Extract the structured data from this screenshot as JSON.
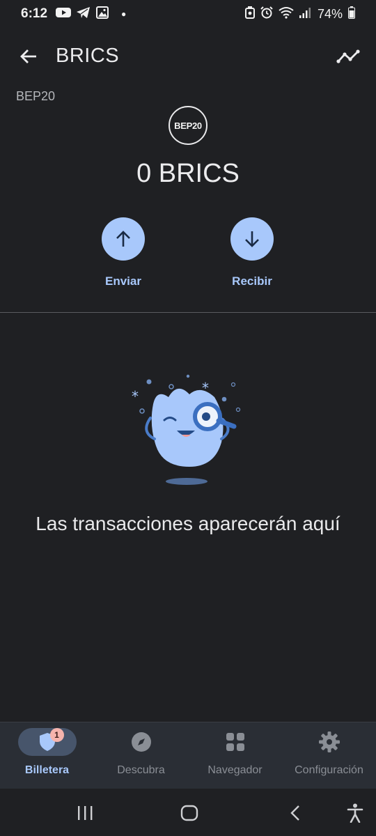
{
  "status_bar": {
    "time": "6:12",
    "battery": "74%",
    "icons_left": [
      "youtube-icon",
      "telegram-icon",
      "image-icon",
      "dot-icon"
    ],
    "icons_right": [
      "battery-saver-icon",
      "alarm-icon",
      "wifi-icon",
      "signal-icon",
      "battery-icon"
    ]
  },
  "header": {
    "title": "BRICS",
    "back_icon": "arrow-left-icon",
    "chart_icon": "trend-line-icon"
  },
  "token": {
    "network": "BEP20",
    "logo_text": "BEP20",
    "balance": "0 BRICS"
  },
  "actions": {
    "send_label": "Enviar",
    "receive_label": "Recibir",
    "accent": "#a8c8fb"
  },
  "empty_state": {
    "message": "Las transacciones aparecerán aquí"
  },
  "bottom_nav": {
    "items": [
      {
        "label": "Billetera",
        "icon": "shield-icon",
        "active": true,
        "badge": "1"
      },
      {
        "label": "Descubra",
        "icon": "compass-icon",
        "active": false
      },
      {
        "label": "Navegador",
        "icon": "grid-icon",
        "active": false
      },
      {
        "label": "Configuración",
        "icon": "gear-icon",
        "active": false
      }
    ]
  },
  "colors": {
    "background": "#1f2023",
    "nav_background": "#2a2e35",
    "accent": "#a8c8fb",
    "badge": "#f6b4ad"
  }
}
